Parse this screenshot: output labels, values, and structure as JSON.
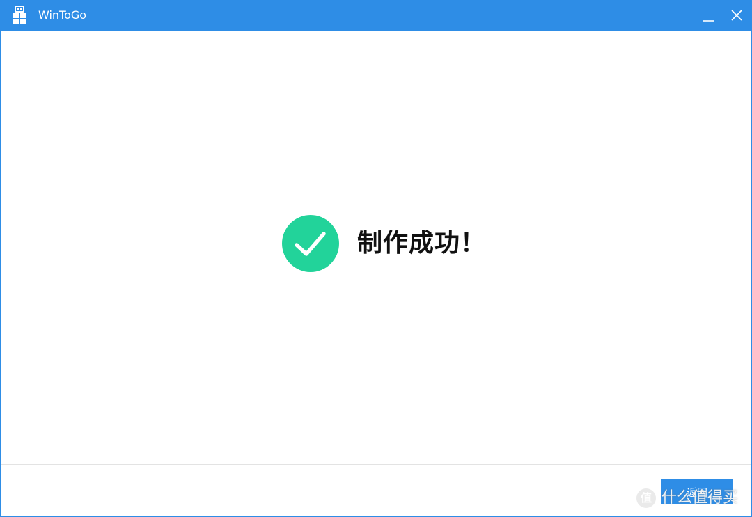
{
  "window": {
    "title": "WinToGo",
    "accent_color": "#2e8de6",
    "controls": {
      "minimize_icon": "minimize-icon",
      "close_icon": "close-icon"
    }
  },
  "main": {
    "status_icon": "check-circle-icon",
    "status_color": "#22d39a",
    "message": "制作成功！"
  },
  "footer": {
    "back_label": "返回"
  },
  "watermark": {
    "badge": "值",
    "text": "什么值得买"
  }
}
